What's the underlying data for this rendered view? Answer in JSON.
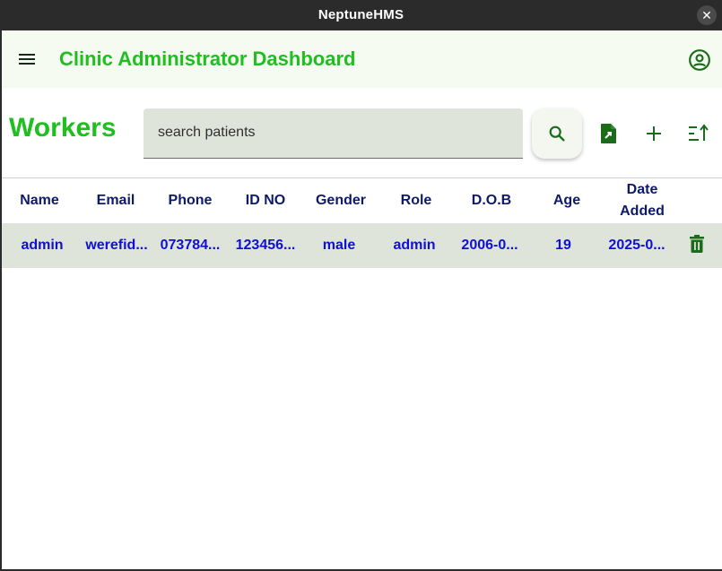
{
  "window": {
    "title": "NeptuneHMS",
    "close_label": "✕"
  },
  "appbar": {
    "title": "Clinic Administrator Dashboard",
    "menu_icon": "hamburger-menu-icon",
    "account_icon": "account-circle-icon"
  },
  "page": {
    "title": "Workers"
  },
  "search": {
    "placeholder": "search patients",
    "value": ""
  },
  "toolbar": {
    "search_icon": "search-icon",
    "export_icon": "file-export-icon",
    "add_icon": "add-icon",
    "sort_icon": "sort-icon"
  },
  "table": {
    "columns": [
      "Name",
      "Email",
      "Phone",
      "ID NO",
      "Gender",
      "Role",
      "D.O.B",
      "Age",
      "Date Added"
    ],
    "rows": [
      {
        "name": "admin",
        "email": "werefid...",
        "phone": "073784...",
        "id_no": "123456...",
        "gender": "male",
        "role": "admin",
        "dob": "2006-0...",
        "age": "19",
        "date_added": "2025-0...",
        "action_icon": "delete-icon"
      }
    ]
  },
  "colors": {
    "accent_green": "#1fbf1f",
    "header_text": "#0d1a6a",
    "cell_text": "#1010d0",
    "row_background": "#dfe4da",
    "appbar_background": "#f6fbf1",
    "icon_green": "#1b6b1b"
  }
}
